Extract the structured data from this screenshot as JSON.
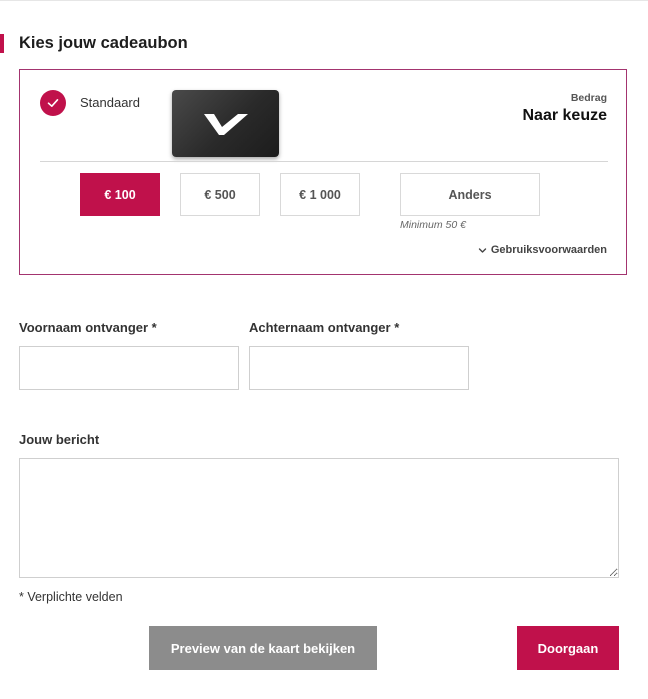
{
  "section_title": "Kies jouw cadeaubon",
  "card": {
    "variant_label": "Standaard",
    "amount_label": "Bedrag",
    "amount_value": "Naar keuze",
    "amounts": [
      "€ 100",
      "€ 500",
      "€ 1 000"
    ],
    "selected_amount": "€ 100",
    "other_label": "Anders",
    "minimum_note": "Minimum 50 €",
    "terms_label": "Gebruiksvoorwaarden"
  },
  "form": {
    "first_name_label": "Voornaam ontvanger *",
    "last_name_label": "Achternaam ontvanger *",
    "message_label": "Jouw bericht",
    "first_name_value": "",
    "last_name_value": "",
    "message_value": "",
    "required_note": "* Verplichte velden"
  },
  "buttons": {
    "preview": "Preview van de kaart bekijken",
    "continue": "Doorgaan"
  },
  "colors": {
    "accent": "#c0114b",
    "card_border": "#a3346f",
    "preview_button": "#8c8c8c"
  }
}
